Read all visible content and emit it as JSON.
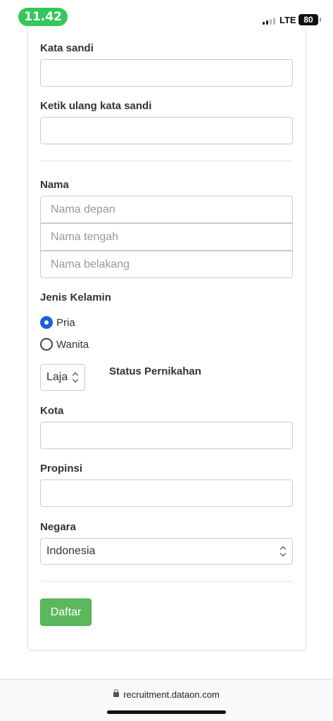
{
  "status_bar": {
    "time": "11.42",
    "network": "LTE",
    "battery": "80"
  },
  "form": {
    "password_label": "Kata sandi",
    "password_value": "",
    "retype_password_label": "Ketik ulang kata sandi",
    "retype_password_value": "",
    "name_label": "Nama",
    "first_name_placeholder": "Nama depan",
    "middle_name_placeholder": "Nama tengah",
    "last_name_placeholder": "Nama belakang",
    "gender_label": "Jenis Kelamin",
    "gender_options": [
      {
        "label": "Pria",
        "checked": true
      },
      {
        "label": "Wanita",
        "checked": false
      }
    ],
    "marital_status_value": "Laja",
    "marital_status_label": "Status Pernikahan",
    "city_label": "Kota",
    "city_value": "",
    "province_label": "Propinsi",
    "province_value": "",
    "country_label": "Negara",
    "country_value": "Indonesia",
    "submit_label": "Daftar"
  },
  "browser": {
    "url": "recruitment.dataon.com"
  },
  "colors": {
    "submit_bg": "#5cb85c",
    "radio_checked": "#1a5fd6",
    "time_pill": "#34c759"
  }
}
